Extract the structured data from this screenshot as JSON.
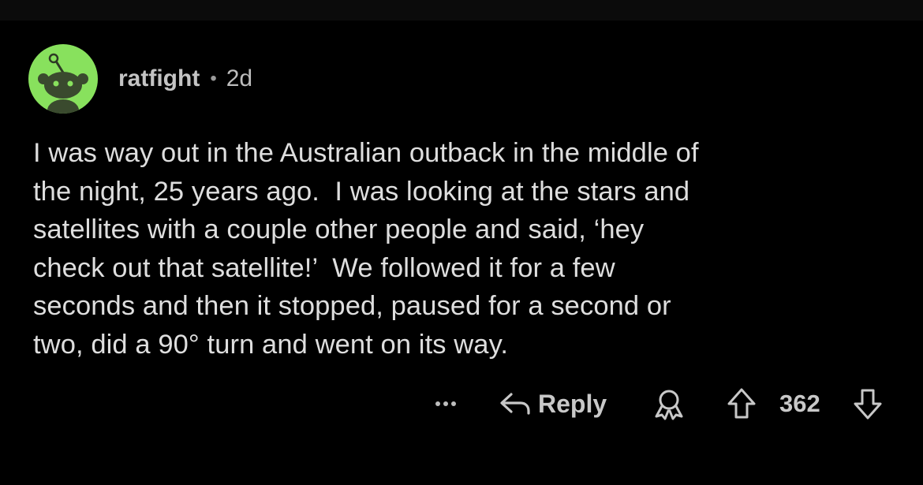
{
  "comment": {
    "author": {
      "username": "ratfight",
      "avatar_color": "#88e15d",
      "avatar_icon": "snoo-avatar-icon"
    },
    "separator": "•",
    "age": "2d",
    "body": "I was way out in the Australian outback in the middle of\nthe night, 25 years ago.  I was looking at the stars and\nsatellites with a couple other people and said, ‘hey\ncheck out that satellite!’  We followed it for a few\nseconds and then it stopped, paused for a second or\ntwo, did a 90° turn and went on its way.",
    "actions": {
      "more_icon": "more-options-icon",
      "reply_icon": "reply-arrow-icon",
      "reply_label": "Reply",
      "award_icon": "award-icon",
      "upvote_icon": "upvote-arrow-icon",
      "score": "362",
      "downvote_icon": "downvote-arrow-icon"
    }
  },
  "colors": {
    "background": "#000000",
    "text": "#dedede",
    "muted": "#b8b8b8"
  }
}
